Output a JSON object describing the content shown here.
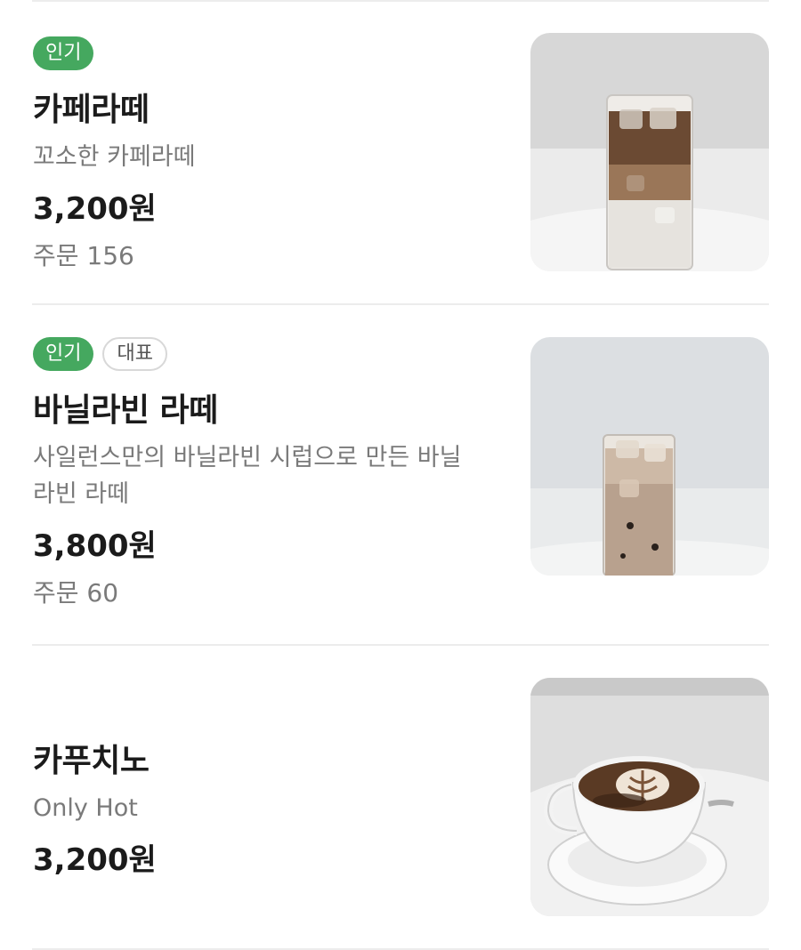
{
  "menu": {
    "items": [
      {
        "badges": [
          "인기"
        ],
        "name": "카페라떼",
        "description": "꼬소한 카페라떼",
        "price": "3,200원",
        "orders": "주문 156",
        "image": "iced-latte-photo"
      },
      {
        "badges": [
          "인기",
          "대표"
        ],
        "name": "바닐라빈 라떼",
        "description_lines": [
          "사일런스만의 바닐라빈 시럽으로 만든 바닐",
          "라빈 라떼"
        ],
        "price": "3,800원",
        "orders": "주문 60",
        "image": "vanilla-latte-photo"
      },
      {
        "name": "카푸치노",
        "description": "Only Hot",
        "price": "3,200원",
        "image": "cappuccino-photo"
      }
    ]
  },
  "colors": {
    "badge_popular": "#45a85f",
    "divider": "#ececec",
    "price_text": "#1b1b1b",
    "muted_text": "#7a7a7a"
  }
}
